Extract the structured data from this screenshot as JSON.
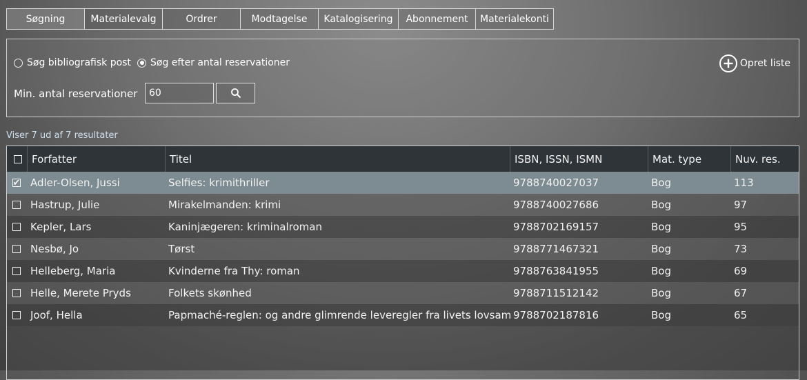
{
  "tabs": [
    {
      "label": "Søgning",
      "active": true
    },
    {
      "label": "Materialevalg",
      "active": false
    },
    {
      "label": "Ordrer",
      "active": false
    },
    {
      "label": "Modtagelse",
      "active": false
    },
    {
      "label": "Katalogisering",
      "active": false
    },
    {
      "label": "Abonnement",
      "active": false
    },
    {
      "label": "Materialekonti",
      "active": false
    }
  ],
  "search": {
    "radio_bibliographic": "Søg bibliografisk post",
    "radio_reservations": "Søg efter antal reservationer",
    "selected_mode": "reservations",
    "min_label": "Min. antal reservationer",
    "min_value": "60",
    "search_icon": "magnifier-icon",
    "create_list_label": "Opret liste",
    "create_list_icon": "plus-circle-icon"
  },
  "results_count": "Viser 7 ud af 7 resultater",
  "table": {
    "headers": [
      "Forfatter",
      "Titel",
      "ISBN, ISSN, ISMN",
      "Mat. type",
      "Nuv. res."
    ],
    "rows": [
      {
        "checked": true,
        "author": "Adler-Olsen, Jussi",
        "title": "Selfies: krimithriller",
        "isbn": "9788740027037",
        "type": "Bog",
        "res": "113"
      },
      {
        "checked": false,
        "author": "Hastrup, Julie",
        "title": "Mirakelmanden: krimi",
        "isbn": "9788740027686",
        "type": "Bog",
        "res": "97"
      },
      {
        "checked": false,
        "author": "Kepler, Lars",
        "title": "Kaninjægeren: kriminalroman",
        "isbn": "9788702169157",
        "type": "Bog",
        "res": "95"
      },
      {
        "checked": false,
        "author": "Nesbø, Jo",
        "title": "Tørst",
        "isbn": "9788771467321",
        "type": "Bog",
        "res": "73"
      },
      {
        "checked": false,
        "author": "Helleberg, Maria",
        "title": "Kvinderne fra Thy: roman",
        "isbn": "9788763841955",
        "type": "Bog",
        "res": "69"
      },
      {
        "checked": false,
        "author": "Helle, Merete Pryds",
        "title": "Folkets skønhed",
        "isbn": "9788711512142",
        "type": "Bog",
        "res": "67"
      },
      {
        "checked": false,
        "author": "Joof, Hella",
        "title": "Papmaché-reglen: og andre glimrende leveregler fra livets lovsamling",
        "isbn": "9788702187816",
        "type": "Bog",
        "res": "65"
      }
    ]
  }
}
